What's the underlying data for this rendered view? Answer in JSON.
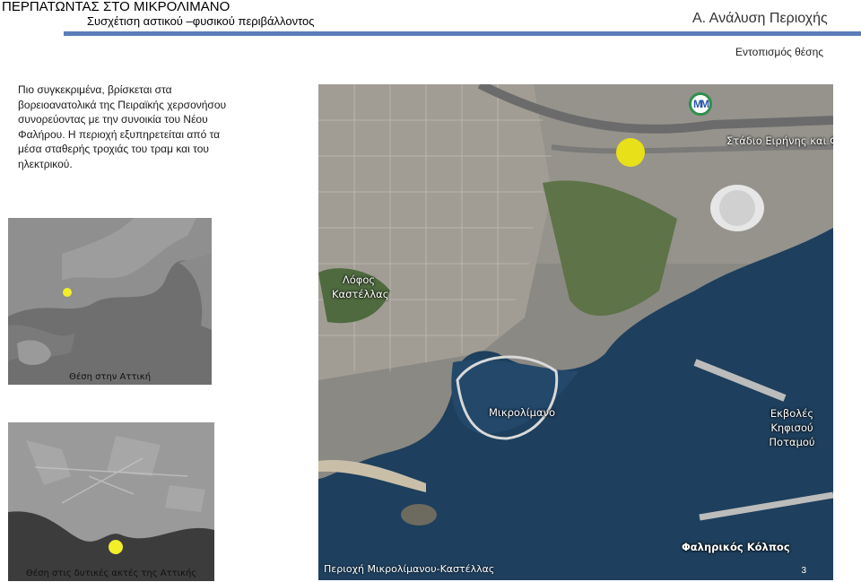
{
  "header": {
    "title": "ΠΕΡΠΑΤΩΝΤΑΣ ΣΤΟ ΜΙΚΡΟΛΙΜΑΝΟ",
    "subtitle": "Συσχέτιση αστικού –φυσικού περιβάλλοντος",
    "section": "Α. Ανάλυση Περιοχής",
    "subsection": "Εντοπισμός θέσης",
    "accent_color": "#5b7db8"
  },
  "description": "Πιο συγκεκριμένα, βρίσκεται στα βορειοανατολικά της Πειραϊκής χερσονήσου συνορεύοντας με την συνοικία του Νέου Φαλήρου. Η περιοχή εξυπηρετείται από τα μέσα σταθερής τροχιάς του τραμ και του ηλεκτρικού.",
  "map": {
    "labels": {
      "stadium": "Στάδιο Ειρήνης και Φιλίας",
      "hill": "Λόφος Καστέλλας",
      "marina": "Μικρολίμανο",
      "river": "Εκβολές Κηφισού Ποταμού",
      "bay": "Φαληρικός Κόλπος"
    },
    "area_caption": "Περιοχή Μικρολίμανου-Καστέλλας",
    "icons": [
      "metro-icon",
      "tram-icon"
    ],
    "marker_color": "#f2ee2a"
  },
  "insets": {
    "attica_caption": "Θέση στην Αττική",
    "coast_caption": "Θέση στις δυτικές ακτές της Αττικής"
  },
  "page_number": "3"
}
